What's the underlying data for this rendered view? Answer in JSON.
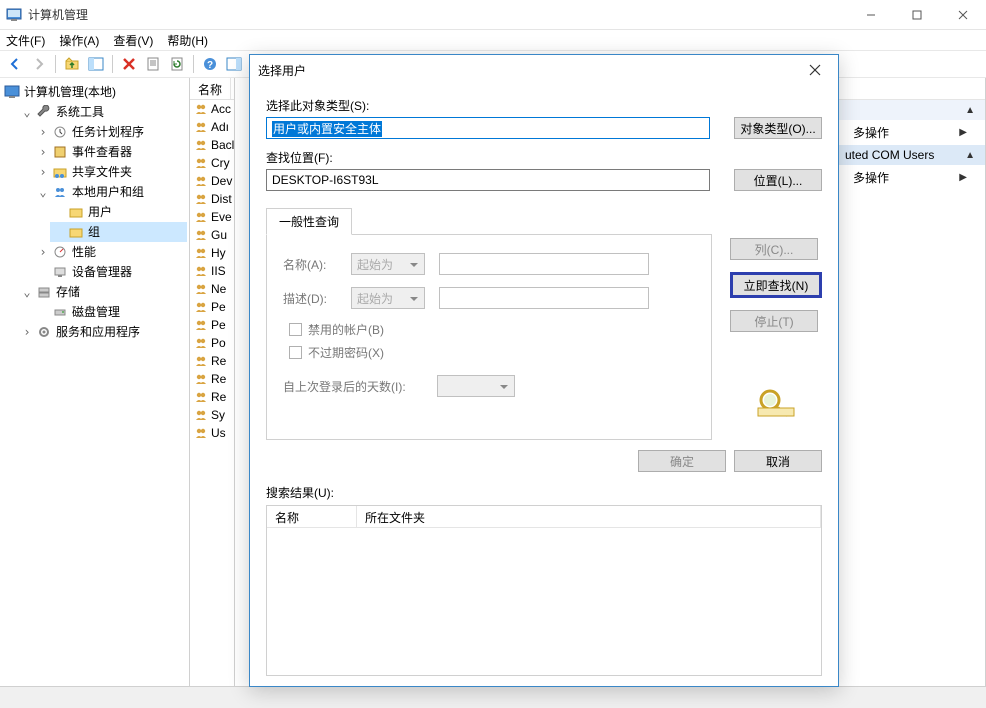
{
  "window": {
    "title": "计算机管理"
  },
  "menu": {
    "file": "文件(F)",
    "action": "操作(A)",
    "view": "查看(V)",
    "help": "帮助(H)"
  },
  "tree": {
    "root": "计算机管理(本地)",
    "sys_tools": "系统工具",
    "task_scheduler": "任务计划程序",
    "event_viewer": "事件查看器",
    "shared_folders": "共享文件夹",
    "local_users": "本地用户和组",
    "users": "用户",
    "groups": "组",
    "performance": "性能",
    "device_manager": "设备管理器",
    "storage": "存储",
    "disk_management": "磁盘管理",
    "services_apps": "服务和应用程序"
  },
  "list": {
    "header_name": "名称",
    "items": [
      "Acc",
      "Adı",
      "Bacl",
      "Cry",
      "Dev",
      "Dist",
      "Eve",
      "Gu",
      "Hy",
      "IIS",
      "Ne",
      "Pe",
      "Pe",
      "Po",
      "Re",
      "Re",
      "Re",
      "Sy",
      "Us"
    ]
  },
  "actions": {
    "section1": "uted COM Users",
    "more_ops": "多操作"
  },
  "dialog": {
    "title": "选择用户",
    "obj_type_label": "选择此对象类型(S):",
    "obj_type_value": "用户或内置安全主体",
    "obj_type_btn": "对象类型(O)...",
    "location_label": "查找位置(F):",
    "location_value": "DESKTOP-I6ST93L",
    "location_btn": "位置(L)...",
    "tab_common": "一般性查询",
    "name_label": "名称(A):",
    "desc_label": "描述(D):",
    "starts_with": "起始为",
    "disabled_accounts": "禁用的帐户(B)",
    "non_expiring_pw": "不过期密码(X)",
    "days_since_logon": "自上次登录后的天数(I):",
    "columns_btn": "列(C)...",
    "find_now_btn": "立即查找(N)",
    "stop_btn": "停止(T)",
    "ok_btn": "确定",
    "cancel_btn": "取消",
    "results_label": "搜索结果(U):",
    "results_col_name": "名称",
    "results_col_folder": "所在文件夹"
  }
}
